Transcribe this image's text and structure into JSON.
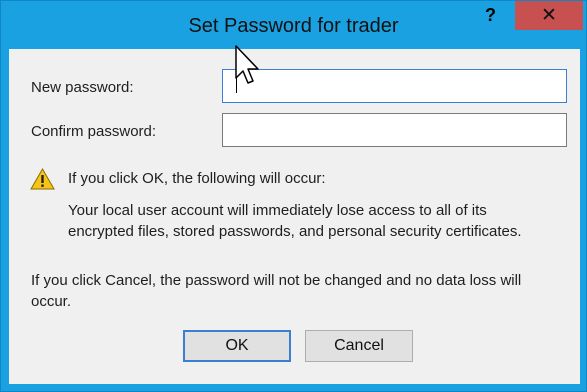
{
  "window": {
    "title": "Set Password for trader",
    "help_label": "?",
    "close_label": "✕"
  },
  "form": {
    "new_password_label": "New password:",
    "new_password_value": "",
    "confirm_password_label": "Confirm password:",
    "confirm_password_value": ""
  },
  "warning": {
    "icon": "warning-triangle-icon",
    "heading": "If you click OK, the following will occur:",
    "details": [
      "Your local user account will immediately lose access to all of its",
      "encrypted files, stored passwords, and personal security certificates."
    ],
    "cancel_note": [
      "If you click Cancel, the password will not be changed and no data loss will",
      "occur."
    ]
  },
  "buttons": {
    "ok_label": "OK",
    "cancel_label": "Cancel"
  },
  "colors": {
    "frame": "#1aa1e2",
    "close_button": "#c75050",
    "client_bg": "#f0f0f0",
    "focus_border": "#3a7fd5"
  }
}
